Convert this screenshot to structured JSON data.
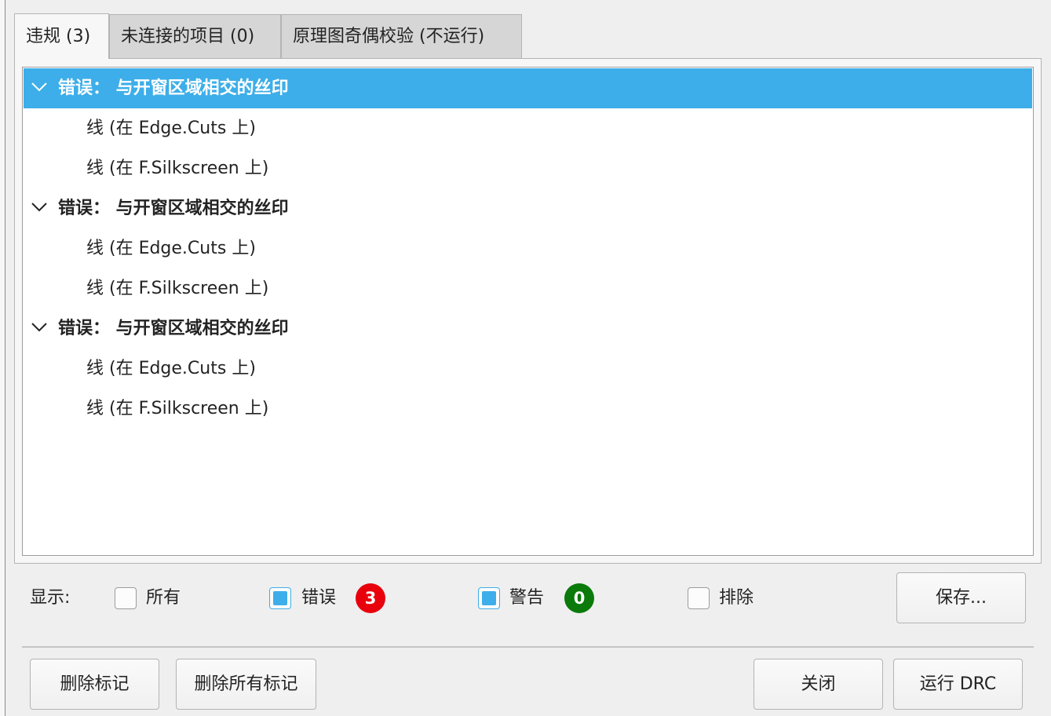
{
  "tabs": [
    {
      "label": "违规 (3)"
    },
    {
      "label": "未连接的项目 (0)"
    },
    {
      "label": "原理图奇偶校验 (不运行)"
    }
  ],
  "violations": [
    {
      "title": "错误：  与开窗区域相交的丝印",
      "items": [
        "线 (在 Edge.Cuts 上)",
        "线 (在 F.Silkscreen 上)"
      ]
    },
    {
      "title": "错误：  与开窗区域相交的丝印",
      "items": [
        "线 (在 Edge.Cuts 上)",
        "线 (在 F.Silkscreen 上)"
      ]
    },
    {
      "title": "错误：  与开窗区域相交的丝印",
      "items": [
        "线 (在 Edge.Cuts 上)",
        "线 (在 F.Silkscreen 上)"
      ]
    }
  ],
  "filters": {
    "show_label": "显示:",
    "all": {
      "label": "所有",
      "checked": false
    },
    "errors": {
      "label": "错误",
      "checked": true,
      "count": "3",
      "badge_color": "#e8000d"
    },
    "warnings": {
      "label": "警告",
      "checked": true,
      "count": "0",
      "badge_color": "#0a7a0a"
    },
    "exclusions": {
      "label": "排除",
      "checked": false
    },
    "save_label": "保存..."
  },
  "actions": {
    "delete_marker": "删除标记",
    "delete_all_markers": "删除所有标记",
    "close": "关闭",
    "run_drc": "运行 DRC"
  },
  "colors": {
    "selection": "#3daee9",
    "checkbox_accent": "#3daee9"
  }
}
